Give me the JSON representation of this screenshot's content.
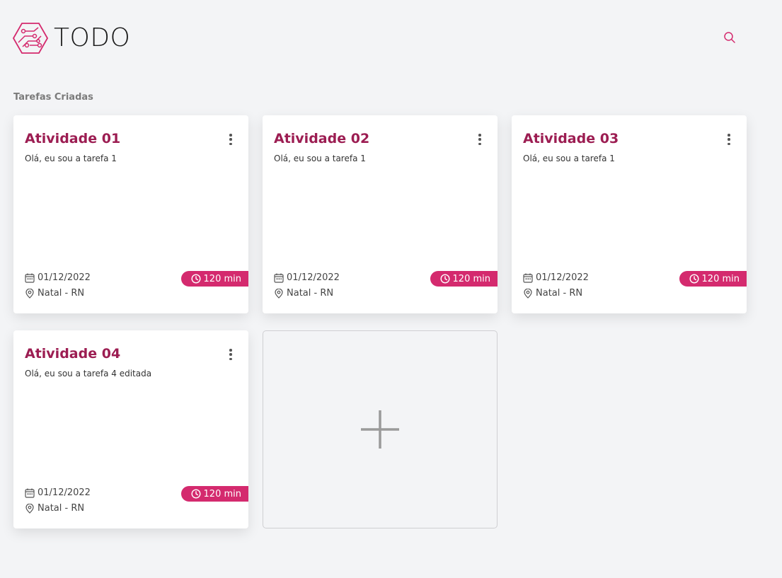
{
  "app": {
    "title": "TODO",
    "logo": "circuit-hexagon-logo",
    "accent_color": "#d42a6e",
    "title_color": "#9c1d52"
  },
  "search": {
    "icon": "search-icon"
  },
  "section": {
    "title": "Tarefas Criadas"
  },
  "tasks": [
    {
      "title": "Atividade 01",
      "description": "Olá, eu sou a tarefa 1",
      "date": "01/12/2022",
      "location": "Natal - RN",
      "duration": "120 min"
    },
    {
      "title": "Atividade 02",
      "description": "Olá, eu sou a tarefa 1",
      "date": "01/12/2022",
      "location": "Natal - RN",
      "duration": "120 min"
    },
    {
      "title": "Atividade 03",
      "description": "Olá, eu sou a tarefa 1",
      "date": "01/12/2022",
      "location": "Natal - RN",
      "duration": "120 min"
    },
    {
      "title": "Atividade 04",
      "description": "Olá, eu sou a tarefa 4 editada",
      "date": "01/12/2022",
      "location": "Natal - RN",
      "duration": "120 min"
    }
  ],
  "add_card": {
    "icon": "plus-icon"
  }
}
